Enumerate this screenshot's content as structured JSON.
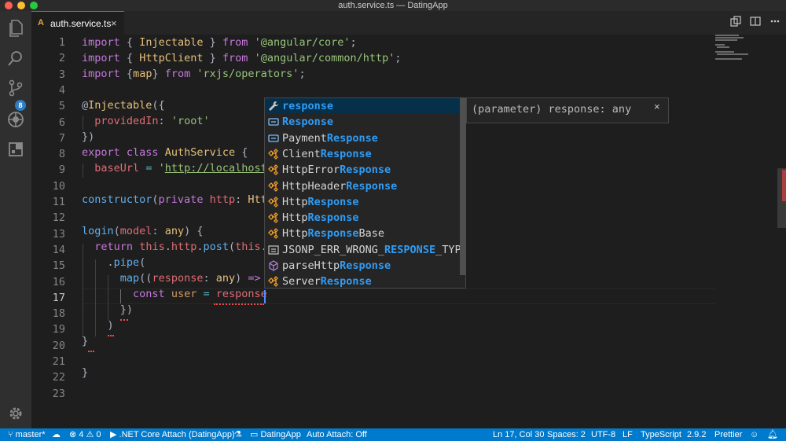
{
  "window": {
    "title": "auth.service.ts — DatingApp"
  },
  "activity_bar": {
    "scm_badge": "8"
  },
  "tab": {
    "label": "auth.service.ts",
    "icon": "A",
    "close": "×"
  },
  "editor": {
    "line_numbers": [
      "1",
      "2",
      "3",
      "4",
      "5",
      "6",
      "7",
      "8",
      "9",
      "10",
      "11",
      "12",
      "13",
      "14",
      "15",
      "16",
      "17",
      "18",
      "19",
      "20",
      "21",
      "22",
      "23"
    ],
    "current_line": "17"
  },
  "suggest": {
    "items": [
      {
        "icon": "wrench-icon",
        "pre": "",
        "match": "response",
        "post": "",
        "selected": true
      },
      {
        "icon": "enum-icon",
        "pre": "",
        "match": "Response",
        "post": ""
      },
      {
        "icon": "enum-icon",
        "pre": "Payment",
        "match": "Response",
        "post": ""
      },
      {
        "icon": "class-icon",
        "pre": "Client",
        "match": "Response",
        "post": ""
      },
      {
        "icon": "class-icon",
        "pre": "HttpError",
        "match": "Response",
        "post": ""
      },
      {
        "icon": "class-icon",
        "pre": "HttpHeader",
        "match": "Response",
        "post": ""
      },
      {
        "icon": "class-icon",
        "pre": "Http",
        "match": "Response",
        "post": ""
      },
      {
        "icon": "class-icon",
        "pre": "Http",
        "match": "Response",
        "post": ""
      },
      {
        "icon": "class-icon",
        "pre": "Http",
        "match": "Response",
        "post": "Base"
      },
      {
        "icon": "constant-icon",
        "pre": "JSONP_ERR_WRONG_",
        "match": "RESPONSE",
        "post": "_TYPI"
      },
      {
        "icon": "module-icon",
        "pre": "parseHttp",
        "match": "Response",
        "post": ""
      },
      {
        "icon": "class-icon",
        "pre": "Server",
        "match": "Response",
        "post": ""
      }
    ],
    "details": "(parameter) response: any",
    "details_close": "×"
  },
  "status_bar": {
    "branch": "master*",
    "errors": "4",
    "warnings": "0",
    "debug": ".NET Core Attach (DatingApp)",
    "folder": "DatingApp",
    "auto_attach": "Auto Attach: Off",
    "position": "Ln 17, Col 30",
    "spaces": "Spaces: 2",
    "encoding": "UTF-8",
    "eol": "LF",
    "language": "TypeScript",
    "ts_version": "2.9.2",
    "formatter": "Prettier"
  }
}
